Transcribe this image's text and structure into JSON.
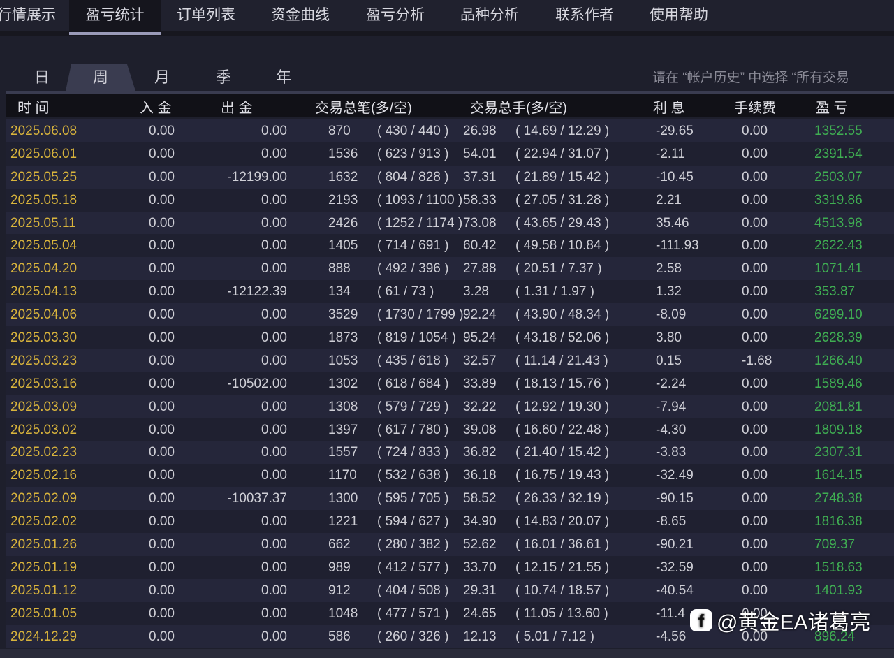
{
  "nav": {
    "tabs": [
      "行情展示",
      "盈亏统计",
      "订单列表",
      "资金曲线",
      "盈亏分析",
      "品种分析",
      "联系作者",
      "使用帮助"
    ],
    "active": 1
  },
  "period_tabs": {
    "items": [
      "日",
      "周",
      "月",
      "季",
      "年"
    ],
    "active": 1
  },
  "hint": "请在 “帐户历史” 中选择 “所有交易",
  "columns": [
    "时 间",
    "入 金",
    "出 金",
    "交易总笔(多/空)",
    "交易总手(多/空)",
    "利 息",
    "手续费",
    "盈 亏"
  ],
  "rows": [
    [
      "2025.06.08",
      "0.00",
      "0.00",
      "870",
      "( 430 / 440 )",
      "26.98",
      "( 14.69 / 12.29 )",
      "-29.65",
      "0.00",
      "1352.55"
    ],
    [
      "2025.06.01",
      "0.00",
      "0.00",
      "1536",
      "( 623 / 913 )",
      "54.01",
      "( 22.94 / 31.07 )",
      "-2.11",
      "0.00",
      "2391.54"
    ],
    [
      "2025.05.25",
      "0.00",
      "-12199.00",
      "1632",
      "( 804 / 828 )",
      "37.31",
      "( 21.89 / 15.42 )",
      "-10.45",
      "0.00",
      "2503.07"
    ],
    [
      "2025.05.18",
      "0.00",
      "0.00",
      "2193",
      "( 1093 / 1100 )",
      "58.33",
      "( 27.05 / 31.28 )",
      "2.21",
      "0.00",
      "3319.86"
    ],
    [
      "2025.05.11",
      "0.00",
      "0.00",
      "2426",
      "( 1252 / 1174 )",
      "73.08",
      "( 43.65 / 29.43 )",
      "35.46",
      "0.00",
      "4513.98"
    ],
    [
      "2025.05.04",
      "0.00",
      "0.00",
      "1405",
      "( 714 / 691 )",
      "60.42",
      "( 49.58 / 10.84 )",
      "-111.93",
      "0.00",
      "2622.43"
    ],
    [
      "2025.04.20",
      "0.00",
      "0.00",
      "888",
      "( 492 / 396 )",
      "27.88",
      "( 20.51 / 7.37 )",
      "2.58",
      "0.00",
      "1071.41"
    ],
    [
      "2025.04.13",
      "0.00",
      "-12122.39",
      "134",
      "( 61 / 73 )",
      "3.28",
      "( 1.31 / 1.97 )",
      "1.32",
      "0.00",
      "353.87"
    ],
    [
      "2025.04.06",
      "0.00",
      "0.00",
      "3529",
      "( 1730 / 1799 )",
      "92.24",
      "( 43.90 / 48.34 )",
      "-8.09",
      "0.00",
      "6299.10"
    ],
    [
      "2025.03.30",
      "0.00",
      "0.00",
      "1873",
      "( 819 / 1054 )",
      "95.24",
      "( 43.18 / 52.06 )",
      "3.80",
      "0.00",
      "2628.39"
    ],
    [
      "2025.03.23",
      "0.00",
      "0.00",
      "1053",
      "( 435 / 618 )",
      "32.57",
      "( 11.14 / 21.43 )",
      "0.15",
      "-1.68",
      "1266.40"
    ],
    [
      "2025.03.16",
      "0.00",
      "-10502.00",
      "1302",
      "( 618 / 684 )",
      "33.89",
      "( 18.13 / 15.76 )",
      "-2.24",
      "0.00",
      "1589.46"
    ],
    [
      "2025.03.09",
      "0.00",
      "0.00",
      "1308",
      "( 579 / 729 )",
      "32.22",
      "( 12.92 / 19.30 )",
      "-7.94",
      "0.00",
      "2081.81"
    ],
    [
      "2025.03.02",
      "0.00",
      "0.00",
      "1397",
      "( 617 / 780 )",
      "39.08",
      "( 16.60 / 22.48 )",
      "-4.30",
      "0.00",
      "1809.18"
    ],
    [
      "2025.02.23",
      "0.00",
      "0.00",
      "1557",
      "( 724 / 833 )",
      "36.82",
      "( 21.40 / 15.42 )",
      "-3.83",
      "0.00",
      "2307.31"
    ],
    [
      "2025.02.16",
      "0.00",
      "0.00",
      "1170",
      "( 532 / 638 )",
      "36.18",
      "( 16.75 / 19.43 )",
      "-32.49",
      "0.00",
      "1614.15"
    ],
    [
      "2025.02.09",
      "0.00",
      "-10037.37",
      "1300",
      "( 595 / 705 )",
      "58.52",
      "( 26.33 / 32.19 )",
      "-90.15",
      "0.00",
      "2748.38"
    ],
    [
      "2025.02.02",
      "0.00",
      "0.00",
      "1221",
      "( 594 / 627 )",
      "34.90",
      "( 14.83 / 20.07 )",
      "-8.65",
      "0.00",
      "1816.38"
    ],
    [
      "2025.01.26",
      "0.00",
      "0.00",
      "662",
      "( 280 / 382 )",
      "52.62",
      "( 16.01 / 36.61 )",
      "-90.21",
      "0.00",
      "709.37"
    ],
    [
      "2025.01.19",
      "0.00",
      "0.00",
      "989",
      "( 412 / 577 )",
      "33.70",
      "( 12.15 / 21.55 )",
      "-32.59",
      "0.00",
      "1518.63"
    ],
    [
      "2025.01.12",
      "0.00",
      "0.00",
      "912",
      "( 404 / 508 )",
      "29.31",
      "( 10.74 / 18.57 )",
      "-40.54",
      "0.00",
      "1401.93"
    ],
    [
      "2025.01.05",
      "0.00",
      "0.00",
      "1048",
      "( 477 / 571 )",
      "24.65",
      "( 11.05 / 13.60 )",
      "-11.4",
      "0.00",
      ""
    ],
    [
      "2024.12.29",
      "0.00",
      "0.00",
      "586",
      "( 260 / 326 )",
      "12.13",
      "( 5.01 / 7.12 )",
      "-4.56",
      "0.00",
      "896.24"
    ]
  ],
  "watermark": "@黄金EA诸葛亮",
  "colors": {
    "date": "#d9b43c",
    "profit": "#3fae52",
    "background": "#1e1f2c"
  }
}
